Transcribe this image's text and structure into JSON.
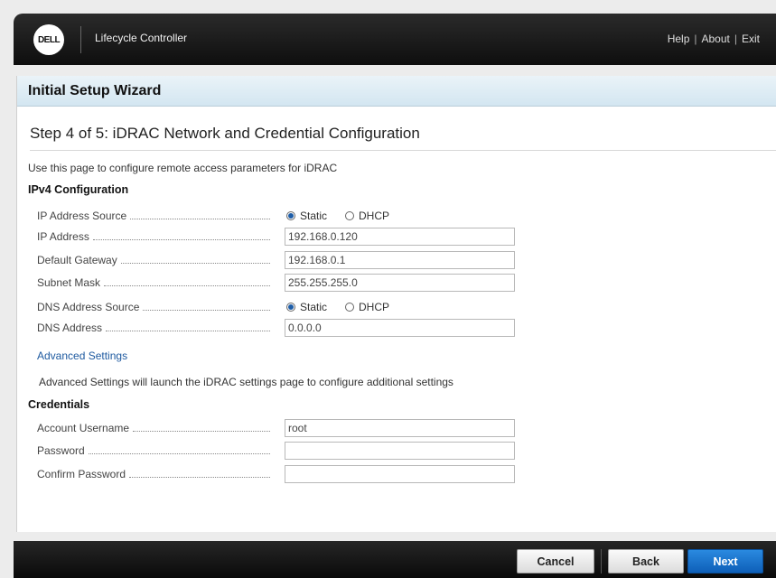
{
  "topbar": {
    "logo_text": "DELL",
    "app_title": "Lifecycle Controller",
    "links": {
      "help": "Help",
      "about": "About",
      "exit": "Exit",
      "separator": "|"
    }
  },
  "wizard": {
    "header": "Initial Setup Wizard",
    "step_title": "Step 4 of 5: iDRAC Network and Credential Configuration",
    "intro": "Use this page to configure remote access parameters for iDRAC"
  },
  "ipv4": {
    "heading": "IPv4 Configuration",
    "ip_address_source": {
      "label": "IP Address Source",
      "options": [
        "Static",
        "DHCP"
      ],
      "selected": "Static"
    },
    "ip_address": {
      "label": "IP Address",
      "value": "192.168.0.120"
    },
    "default_gateway": {
      "label": "Default Gateway",
      "value": "192.168.0.1"
    },
    "subnet_mask": {
      "label": "Subnet Mask",
      "value": "255.255.255.0"
    },
    "dns_address_source": {
      "label": "DNS Address Source",
      "options": [
        "Static",
        "DHCP"
      ],
      "selected": "Static"
    },
    "dns_address": {
      "label": "DNS Address",
      "value": "0.0.0.0"
    }
  },
  "advanced": {
    "link": "Advanced Settings",
    "description": "Advanced Settings will launch the iDRAC settings page to configure additional settings"
  },
  "credentials": {
    "heading": "Credentials",
    "account_username": {
      "label": "Account Username",
      "value": "root"
    },
    "password": {
      "label": "Password",
      "value": ""
    },
    "confirm_password": {
      "label": "Confirm Password",
      "value": ""
    }
  },
  "footer": {
    "cancel": "Cancel",
    "back": "Back",
    "next": "Next"
  },
  "colors": {
    "accent": "#0e5fb8",
    "link": "#1e5aa0",
    "header_bg": "#d3e6f1"
  }
}
